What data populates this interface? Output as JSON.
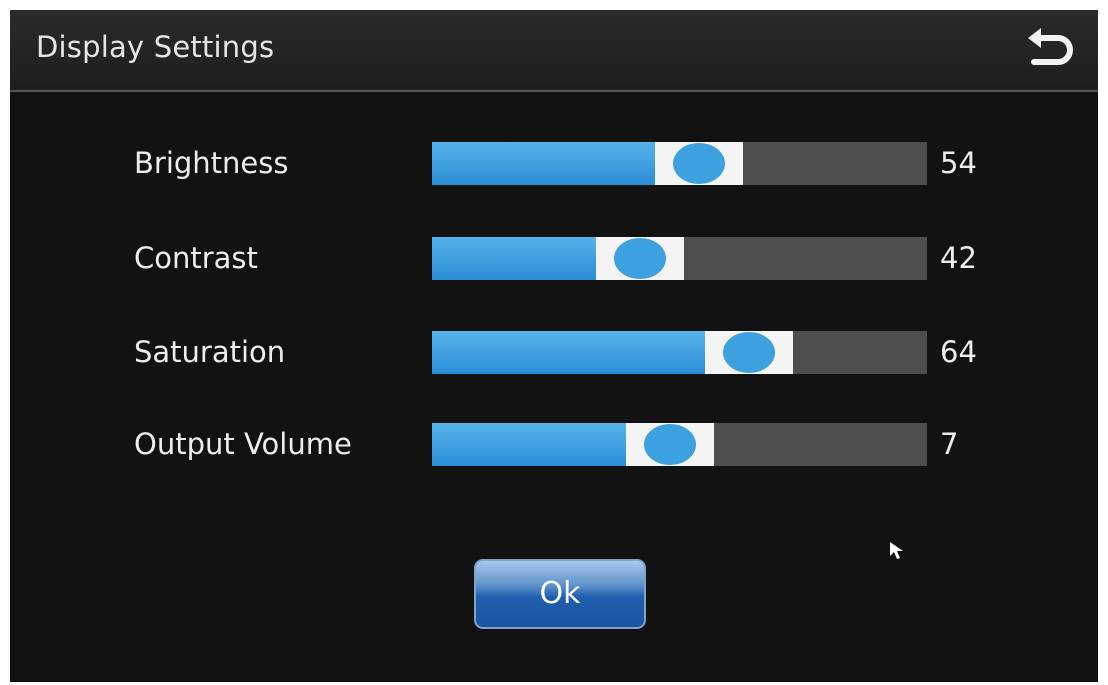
{
  "header": {
    "title": "Display Settings",
    "back_icon": "undo-arrow-icon"
  },
  "sliders": [
    {
      "label": "Brightness",
      "value": "54",
      "fraction": 0.54
    },
    {
      "label": "Contrast",
      "value": "42",
      "fraction": 0.42
    },
    {
      "label": "Saturation",
      "value": "64",
      "fraction": 0.64
    },
    {
      "label": "Output Volume",
      "value": "7",
      "fraction": 0.48
    }
  ],
  "footer": {
    "ok_label": "Ok"
  },
  "colors": {
    "accent": "#3da0df",
    "background": "#121212",
    "track": "#4e4e4e"
  }
}
